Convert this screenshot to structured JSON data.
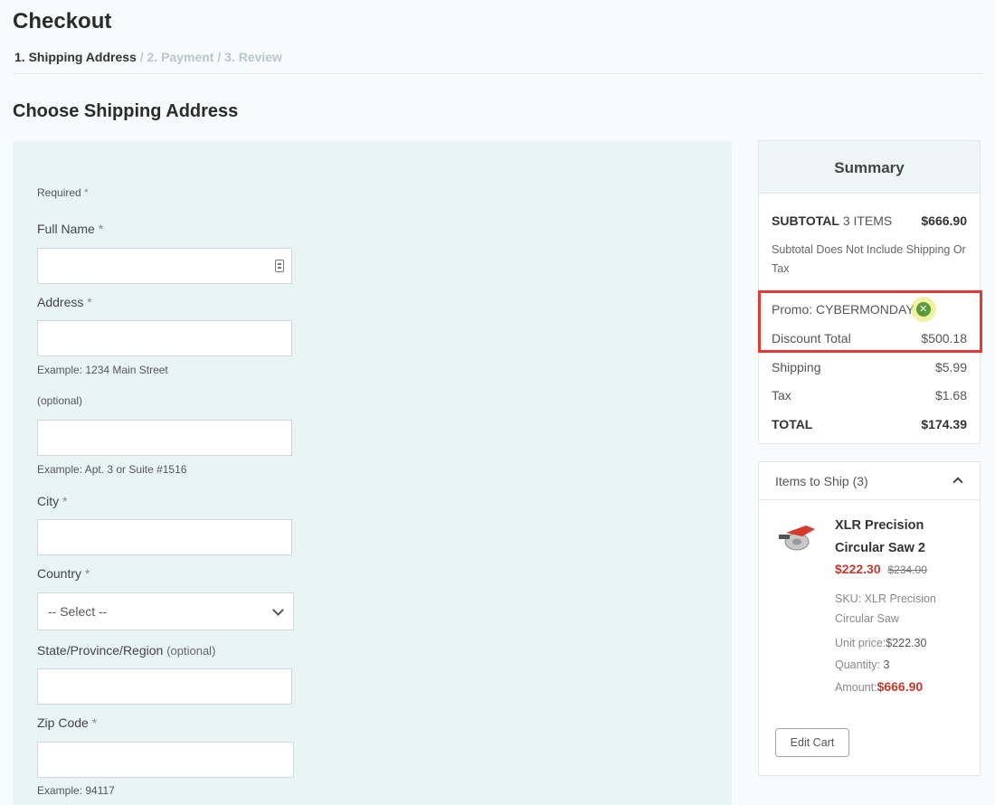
{
  "page": {
    "title": "Checkout",
    "steps": [
      {
        "label": "1. Shipping Address"
      },
      {
        "label": "2. Payment"
      },
      {
        "label": "3. Review"
      }
    ],
    "separator": "/",
    "section_title": "Choose Shipping Address"
  },
  "form": {
    "required_note": "Required",
    "required_mark": "*",
    "full_name": {
      "label": "Full Name",
      "value": ""
    },
    "address": {
      "label": "Address",
      "value": "",
      "hint": "Example: 1234 Main Street"
    },
    "address2": {
      "label": "(optional)",
      "value": "",
      "hint": "Example: Apt. 3 or Suite #1516"
    },
    "city": {
      "label": "City",
      "value": ""
    },
    "country": {
      "label": "Country",
      "selected": "-- Select --"
    },
    "state": {
      "label": "State/Province/Region",
      "optional": "(optional)",
      "value": ""
    },
    "zip": {
      "label": "Zip Code",
      "value": "",
      "hint": "Example: 94117"
    }
  },
  "summary": {
    "title": "Summary",
    "subtotal_label": "SUBTOTAL",
    "subtotal_items": "3 ITEMS",
    "subtotal_value": "$666.90",
    "subtotal_note": "Subtotal Does Not Include Shipping Or Tax",
    "promo_label": "Promo: CYBERMONDAY",
    "discount_label": "Discount Total",
    "discount_value": "$500.18",
    "shipping_label": "Shipping",
    "shipping_value": "$5.99",
    "tax_label": "Tax",
    "tax_value": "$1.68",
    "total_label": "TOTAL",
    "total_value": "$174.39"
  },
  "items": {
    "header": "Items to Ship (3)",
    "product": {
      "name": "XLR Precision Circular Saw 2",
      "price": "$222.30",
      "original_price": "$234.00",
      "sku_label": "SKU:",
      "sku": "XLR Precision Circular Saw",
      "unit_price_label": "Unit price:",
      "unit_price": "$222.30",
      "quantity_label": "Quantity:",
      "quantity": "3",
      "amount_label": "Amount:",
      "amount": "$666.90"
    },
    "edit_cart": "Edit Cart"
  },
  "colors": {
    "highlight_border": "#e53935",
    "sale_price": "#c0392b",
    "panel_bg": "#e9f5f5"
  }
}
